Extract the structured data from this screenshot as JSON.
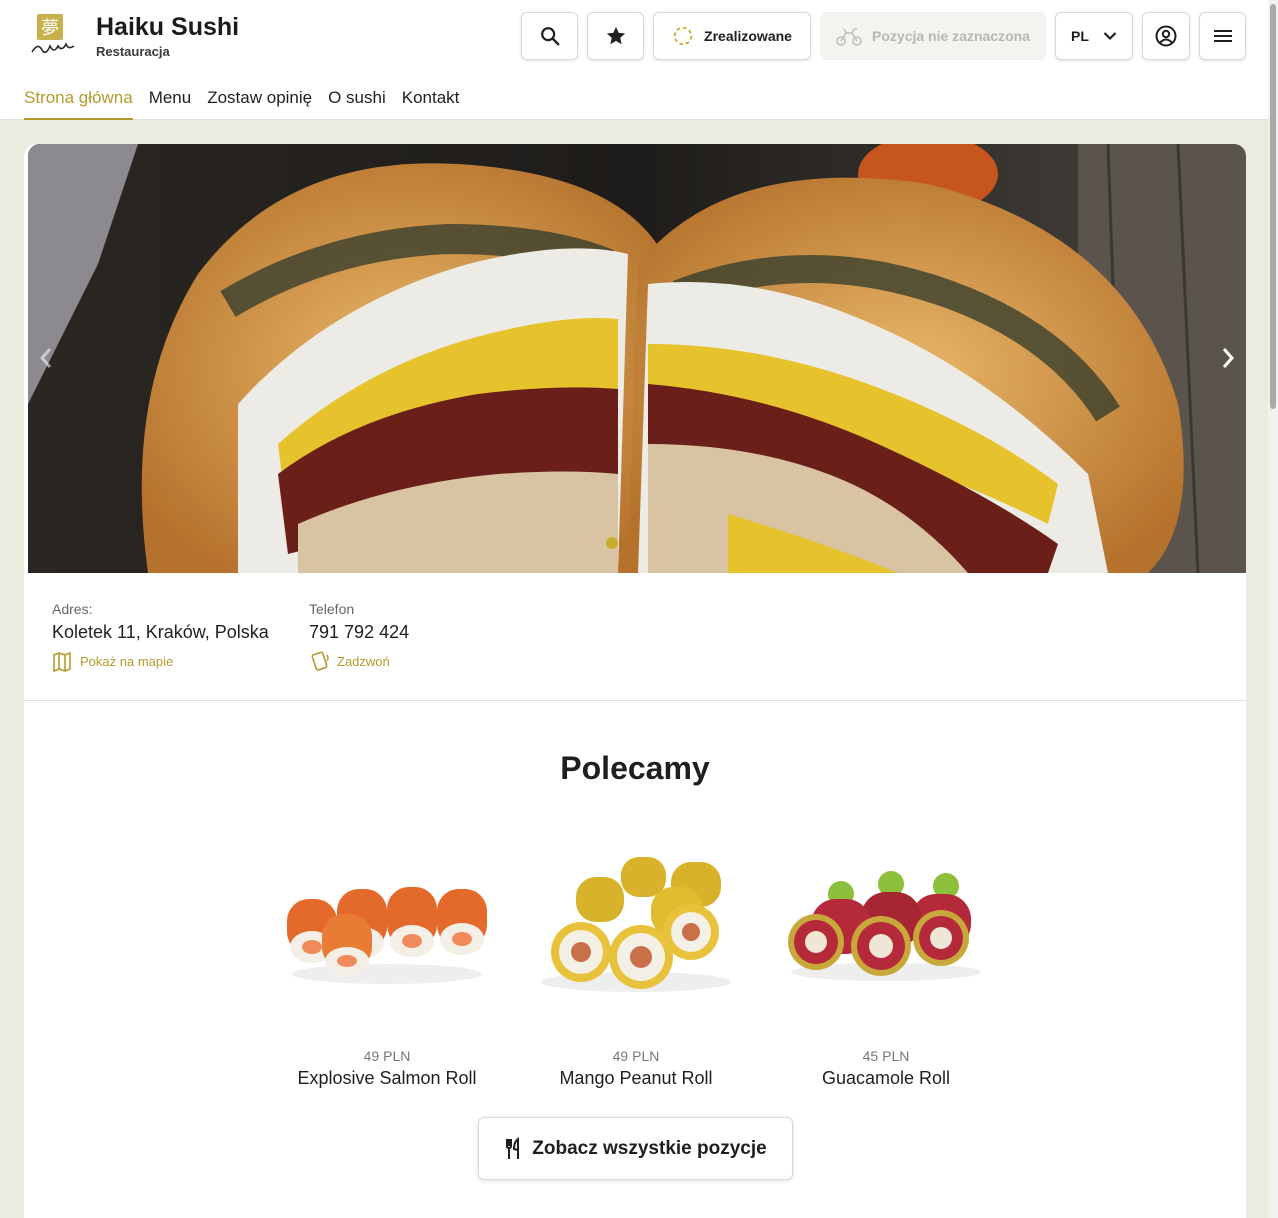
{
  "header": {
    "brand_title": "Haiku Sushi",
    "brand_subtitle": "Restauracja",
    "status_label": "Zrealizowane",
    "position_label": "Pozycja nie zaznaczona",
    "language": "PL",
    "accent_color": "#b39a2c"
  },
  "nav": {
    "items": [
      "Strona główna",
      "Menu",
      "Zostaw opinię",
      "O sushi",
      "Kontakt"
    ],
    "active_index": 0
  },
  "info": {
    "address_label": "Adres:",
    "address_value": "Koletek 11, Kraków, Polska",
    "map_link": "Pokaż na mapie",
    "phone_label": "Telefon",
    "phone_value": "791 792 424",
    "call_link": "Zadzwoń"
  },
  "recommended": {
    "title": "Polecamy",
    "products": [
      {
        "name": "Explosive Salmon Roll",
        "price": "49 PLN"
      },
      {
        "name": "Mango Peanut Roll",
        "price": "49 PLN"
      },
      {
        "name": "Guacamole Roll",
        "price": "45 PLN"
      }
    ],
    "all_button": "Zobacz wszystkie pozycje"
  },
  "carousel": {
    "slide_count": 1,
    "active_slide": 1
  }
}
